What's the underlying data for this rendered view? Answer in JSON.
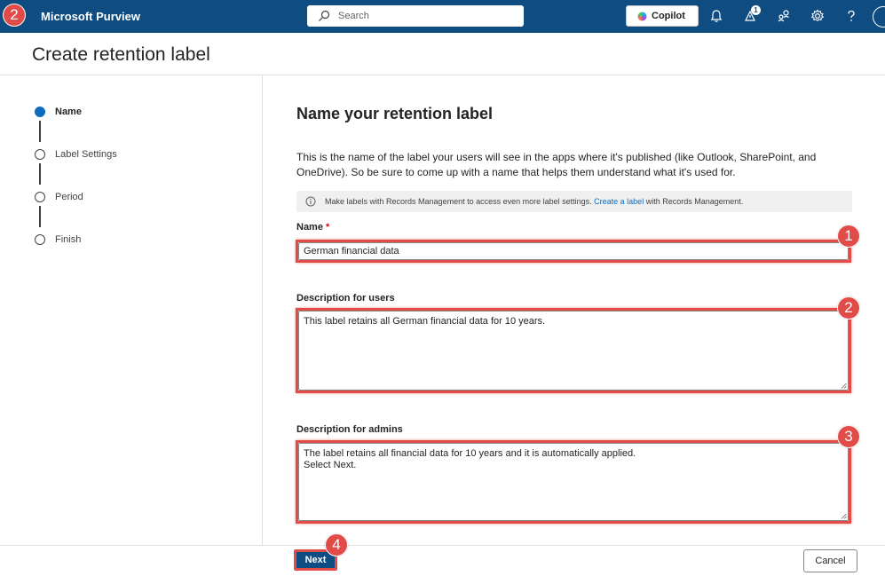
{
  "app": {
    "brand": "Microsoft Purview"
  },
  "topbar": {
    "search_placeholder": "Search",
    "copilot_label": "Copilot",
    "notification_count": "1",
    "icons": [
      "bell-icon",
      "notification-icon",
      "people-icon",
      "gear-icon",
      "help-icon",
      "avatar"
    ]
  },
  "page": {
    "title": "Create retention label"
  },
  "steps": [
    {
      "label": "Name",
      "active": true
    },
    {
      "label": "Label Settings",
      "active": false
    },
    {
      "label": "Period",
      "active": false
    },
    {
      "label": "Finish",
      "active": false
    }
  ],
  "main": {
    "heading": "Name your retention label",
    "intro": "This is the name of the label your users will see in the apps where it's published (like Outlook, SharePoint, and OneDrive). So be sure to come up with a name that helps them understand what it's used for.",
    "info_before": "Make labels with Records Management to access even more label settings. ",
    "info_link": "Create a label",
    "info_after": " with Records Management.",
    "name_label": "Name",
    "name_required": "*",
    "name_value": "German financial data",
    "desc_users_label": "Description for users",
    "desc_users_value": "This label retains all German financial data for 10 years.",
    "desc_admins_label": "Description for admins",
    "desc_admins_value": "The label retains all financial data for 10 years and it is automatically applied.\nSelect Next."
  },
  "footer": {
    "next_label": "Next",
    "cancel_label": "Cancel"
  },
  "annotations": [
    "2",
    "1",
    "2",
    "3",
    "4"
  ],
  "colors": {
    "topbar": "#0f4c81",
    "accent": "#0f6cbd",
    "annotation": "#e14b48"
  }
}
